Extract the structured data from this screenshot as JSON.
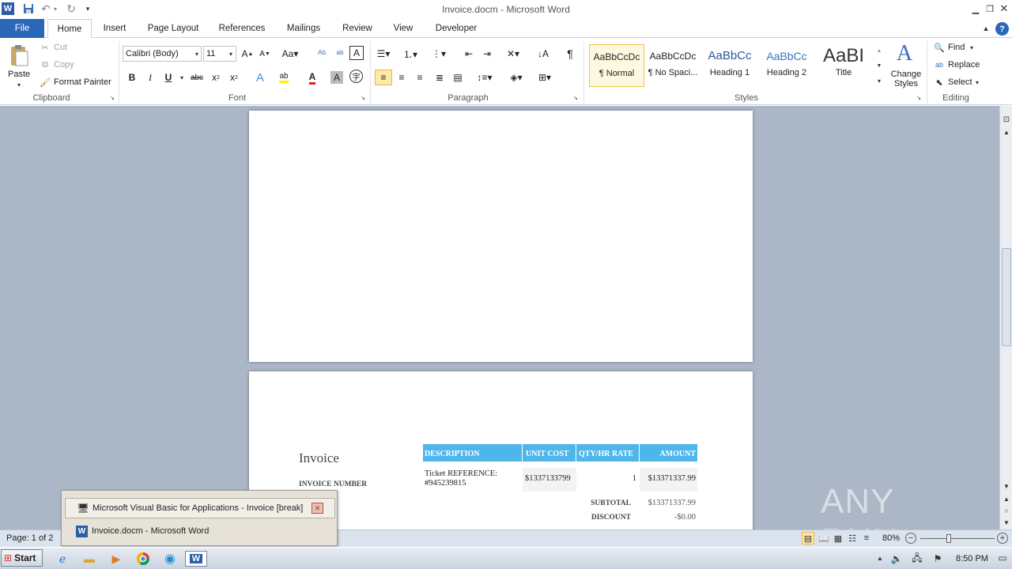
{
  "window": {
    "title": "Invoice.docm - Microsoft Word"
  },
  "tabs": [
    {
      "label": "File"
    },
    {
      "label": "Home"
    },
    {
      "label": "Insert"
    },
    {
      "label": "Page Layout"
    },
    {
      "label": "References"
    },
    {
      "label": "Mailings"
    },
    {
      "label": "Review"
    },
    {
      "label": "View"
    },
    {
      "label": "Developer"
    }
  ],
  "ribbon": {
    "clipboard": {
      "paste": "Paste",
      "cut": "Cut",
      "copy": "Copy",
      "format_painter": "Format Painter",
      "label": "Clipboard"
    },
    "font": {
      "name": "Calibri (Body)",
      "size": "11",
      "label": "Font"
    },
    "paragraph": {
      "label": "Paragraph"
    },
    "styles": {
      "label": "Styles",
      "items": [
        {
          "preview": "AaBbCcDc",
          "name": "¶ Normal"
        },
        {
          "preview": "AaBbCcDc",
          "name": "¶ No Spaci..."
        },
        {
          "preview": "AaBbCc",
          "name": "Heading 1"
        },
        {
          "preview": "AaBbCc",
          "name": "Heading 2"
        },
        {
          "preview": "AaBI",
          "name": "Title"
        }
      ],
      "change": "Change Styles"
    },
    "editing": {
      "find": "Find",
      "replace": "Replace",
      "select": "Select",
      "label": "Editing"
    }
  },
  "invoice": {
    "title": "Invoice",
    "number_label": "INVOICE NUMBER",
    "headers": [
      "DESCRIPTION",
      "UNIT COST",
      "QTY/HR RATE",
      "AMOUNT"
    ],
    "row": {
      "description": "Ticket REFERENCE: #945239815",
      "unit_cost": "$1337133799",
      "qty": "1",
      "amount": "$13371337.99"
    },
    "subtotal_label": "SUBTOTAL",
    "subtotal": "$13371337.99",
    "discount_label": "DISCOUNT",
    "discount": "-$0.00"
  },
  "popup": {
    "items": [
      {
        "label": "Microsoft Visual Basic for Applications - Invoice [break]"
      },
      {
        "label": "Invoice.docm - Microsoft Word"
      }
    ]
  },
  "status": {
    "page": "Page: 1 of 2",
    "zoom": "80%"
  },
  "taskbar": {
    "start": "Start",
    "time": "8:50 PM"
  },
  "watermark": "ANY RUN",
  "colors": {
    "accent": "#2a67b8",
    "table_header": "#4fb6ec"
  }
}
